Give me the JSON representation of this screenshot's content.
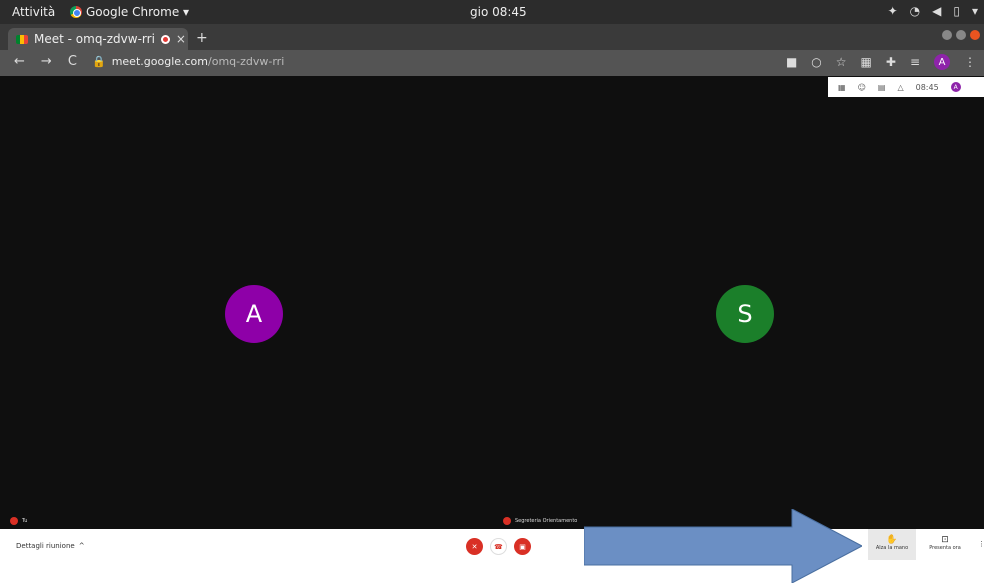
{
  "topbar": {
    "activities": "Attività",
    "app_name": "Google Chrome ▾",
    "clock": "gio 08:45"
  },
  "browser": {
    "tab_title": "Meet - omq-zdvw-rri",
    "tab_close": "×",
    "new_tab": "+",
    "url_host": "meet.google.com",
    "url_path": "/omq-zdvw-rri",
    "profile_initial": "A"
  },
  "meet_overlay": {
    "time": "08:45",
    "profile_initial": "A"
  },
  "participants": [
    {
      "initial": "A",
      "name": "Tu",
      "color": "#8e00a8"
    },
    {
      "initial": "S",
      "name": "Segreteria Orientamento",
      "color": "#1b7f2a"
    }
  ],
  "controls": {
    "meeting_details": "Dettagli riunione",
    "details_chevron": "^",
    "raise_hand": "Alza la mano",
    "present": "Presenta ora",
    "more": "⋮"
  },
  "colors": {
    "mic_off": "#d93025",
    "annotation_arrow": "#6b8fc4"
  }
}
